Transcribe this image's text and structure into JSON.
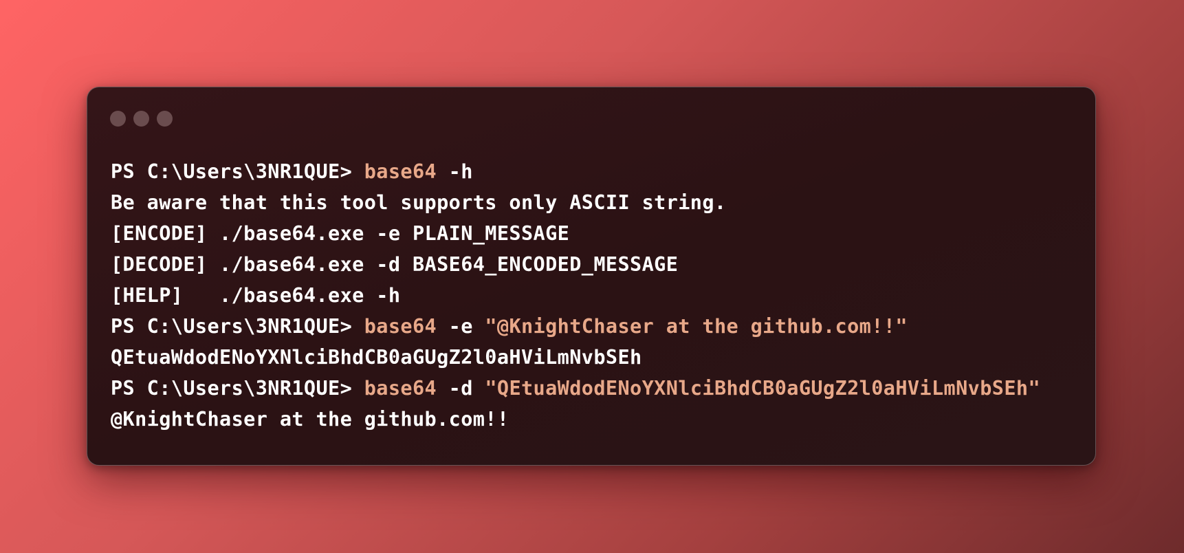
{
  "colors": {
    "window_bg": "#2b1214",
    "text": "#ffffff",
    "command_highlight": "#e8a889",
    "window_dot": "#6a4c4e"
  },
  "window_controls": [
    "close-dot",
    "minimize-dot",
    "maximize-dot"
  ],
  "terminal": {
    "lines": [
      {
        "prompt": "PS C:\\Users\\3NR1QUE> ",
        "command": "base64",
        "args": " -h",
        "string": ""
      },
      {
        "text": "Be aware that this tool supports only ASCII string."
      },
      {
        "text": "[ENCODE] ./base64.exe -e PLAIN_MESSAGE"
      },
      {
        "text": "[DECODE] ./base64.exe -d BASE64_ENCODED_MESSAGE"
      },
      {
        "text": "[HELP]   ./base64.exe -h"
      },
      {
        "prompt": "PS C:\\Users\\3NR1QUE> ",
        "command": "base64",
        "args": " -e ",
        "string": "\"@KnightChaser at the github.com!!\""
      },
      {
        "text": "QEtuaWdodENoYXNlciBhdCB0aGUgZ2l0aHViLmNvbSEh"
      },
      {
        "prompt": "PS C:\\Users\\3NR1QUE> ",
        "command": "base64",
        "args": " -d ",
        "string": "\"QEtuaWdodENoYXNlciBhdCB0aGUgZ2l0aHViLmNvbSEh\""
      },
      {
        "text": "@KnightChaser at the github.com!!"
      }
    ]
  }
}
